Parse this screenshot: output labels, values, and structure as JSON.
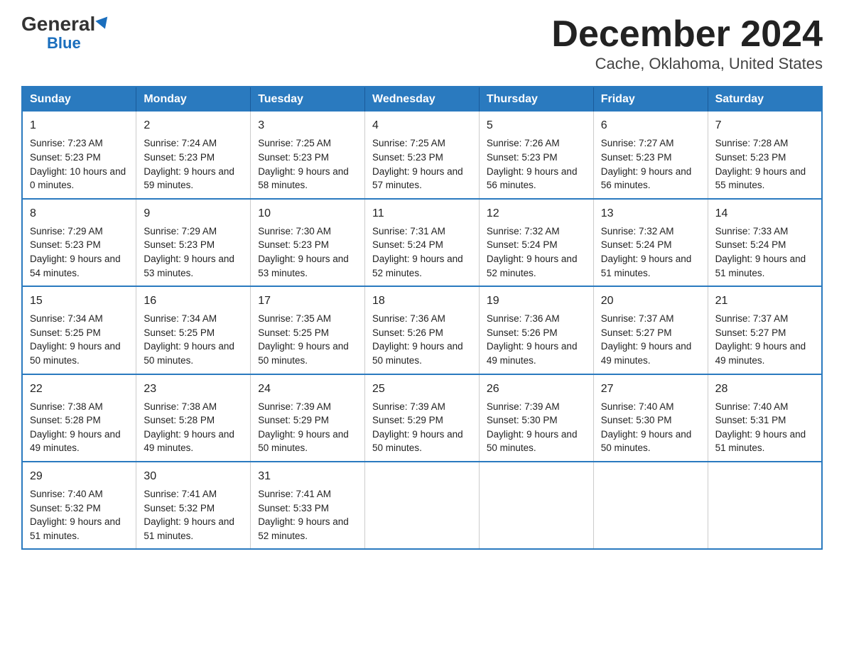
{
  "logo": {
    "general": "General",
    "arrow_char": "▶",
    "blue": "Blue"
  },
  "title": "December 2024",
  "subtitle": "Cache, Oklahoma, United States",
  "days_header": [
    "Sunday",
    "Monday",
    "Tuesday",
    "Wednesday",
    "Thursday",
    "Friday",
    "Saturday"
  ],
  "weeks": [
    [
      {
        "day": "1",
        "sunrise": "7:23 AM",
        "sunset": "5:23 PM",
        "daylight": "10 hours and 0 minutes."
      },
      {
        "day": "2",
        "sunrise": "7:24 AM",
        "sunset": "5:23 PM",
        "daylight": "9 hours and 59 minutes."
      },
      {
        "day": "3",
        "sunrise": "7:25 AM",
        "sunset": "5:23 PM",
        "daylight": "9 hours and 58 minutes."
      },
      {
        "day": "4",
        "sunrise": "7:25 AM",
        "sunset": "5:23 PM",
        "daylight": "9 hours and 57 minutes."
      },
      {
        "day": "5",
        "sunrise": "7:26 AM",
        "sunset": "5:23 PM",
        "daylight": "9 hours and 56 minutes."
      },
      {
        "day": "6",
        "sunrise": "7:27 AM",
        "sunset": "5:23 PM",
        "daylight": "9 hours and 56 minutes."
      },
      {
        "day": "7",
        "sunrise": "7:28 AM",
        "sunset": "5:23 PM",
        "daylight": "9 hours and 55 minutes."
      }
    ],
    [
      {
        "day": "8",
        "sunrise": "7:29 AM",
        "sunset": "5:23 PM",
        "daylight": "9 hours and 54 minutes."
      },
      {
        "day": "9",
        "sunrise": "7:29 AM",
        "sunset": "5:23 PM",
        "daylight": "9 hours and 53 minutes."
      },
      {
        "day": "10",
        "sunrise": "7:30 AM",
        "sunset": "5:23 PM",
        "daylight": "9 hours and 53 minutes."
      },
      {
        "day": "11",
        "sunrise": "7:31 AM",
        "sunset": "5:24 PM",
        "daylight": "9 hours and 52 minutes."
      },
      {
        "day": "12",
        "sunrise": "7:32 AM",
        "sunset": "5:24 PM",
        "daylight": "9 hours and 52 minutes."
      },
      {
        "day": "13",
        "sunrise": "7:32 AM",
        "sunset": "5:24 PM",
        "daylight": "9 hours and 51 minutes."
      },
      {
        "day": "14",
        "sunrise": "7:33 AM",
        "sunset": "5:24 PM",
        "daylight": "9 hours and 51 minutes."
      }
    ],
    [
      {
        "day": "15",
        "sunrise": "7:34 AM",
        "sunset": "5:25 PM",
        "daylight": "9 hours and 50 minutes."
      },
      {
        "day": "16",
        "sunrise": "7:34 AM",
        "sunset": "5:25 PM",
        "daylight": "9 hours and 50 minutes."
      },
      {
        "day": "17",
        "sunrise": "7:35 AM",
        "sunset": "5:25 PM",
        "daylight": "9 hours and 50 minutes."
      },
      {
        "day": "18",
        "sunrise": "7:36 AM",
        "sunset": "5:26 PM",
        "daylight": "9 hours and 50 minutes."
      },
      {
        "day": "19",
        "sunrise": "7:36 AM",
        "sunset": "5:26 PM",
        "daylight": "9 hours and 49 minutes."
      },
      {
        "day": "20",
        "sunrise": "7:37 AM",
        "sunset": "5:27 PM",
        "daylight": "9 hours and 49 minutes."
      },
      {
        "day": "21",
        "sunrise": "7:37 AM",
        "sunset": "5:27 PM",
        "daylight": "9 hours and 49 minutes."
      }
    ],
    [
      {
        "day": "22",
        "sunrise": "7:38 AM",
        "sunset": "5:28 PM",
        "daylight": "9 hours and 49 minutes."
      },
      {
        "day": "23",
        "sunrise": "7:38 AM",
        "sunset": "5:28 PM",
        "daylight": "9 hours and 49 minutes."
      },
      {
        "day": "24",
        "sunrise": "7:39 AM",
        "sunset": "5:29 PM",
        "daylight": "9 hours and 50 minutes."
      },
      {
        "day": "25",
        "sunrise": "7:39 AM",
        "sunset": "5:29 PM",
        "daylight": "9 hours and 50 minutes."
      },
      {
        "day": "26",
        "sunrise": "7:39 AM",
        "sunset": "5:30 PM",
        "daylight": "9 hours and 50 minutes."
      },
      {
        "day": "27",
        "sunrise": "7:40 AM",
        "sunset": "5:30 PM",
        "daylight": "9 hours and 50 minutes."
      },
      {
        "day": "28",
        "sunrise": "7:40 AM",
        "sunset": "5:31 PM",
        "daylight": "9 hours and 51 minutes."
      }
    ],
    [
      {
        "day": "29",
        "sunrise": "7:40 AM",
        "sunset": "5:32 PM",
        "daylight": "9 hours and 51 minutes."
      },
      {
        "day": "30",
        "sunrise": "7:41 AM",
        "sunset": "5:32 PM",
        "daylight": "9 hours and 51 minutes."
      },
      {
        "day": "31",
        "sunrise": "7:41 AM",
        "sunset": "5:33 PM",
        "daylight": "9 hours and 52 minutes."
      },
      null,
      null,
      null,
      null
    ]
  ],
  "labels": {
    "sunrise_prefix": "Sunrise: ",
    "sunset_prefix": "Sunset: ",
    "daylight_prefix": "Daylight: "
  }
}
